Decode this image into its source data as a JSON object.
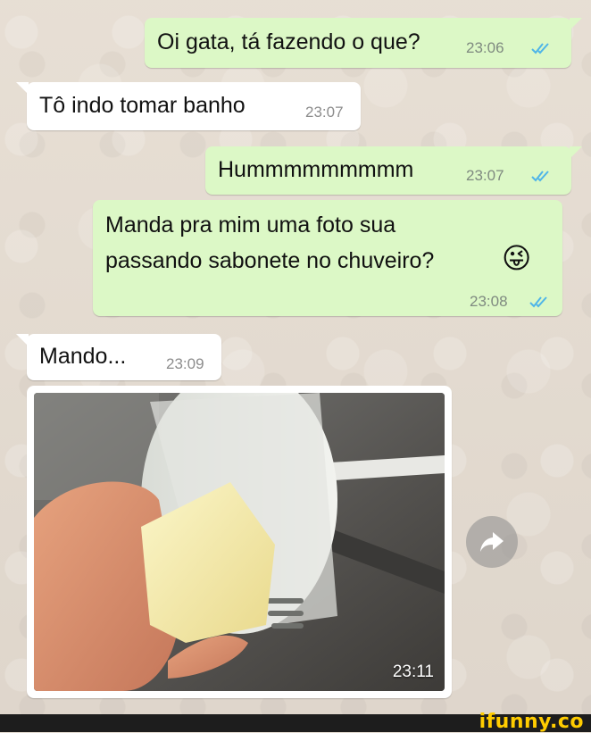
{
  "conversation": {
    "messages": [
      {
        "direction": "outgoing",
        "text": "Oi gata, tá fazendo o que?",
        "time": "23:06",
        "status": "read"
      },
      {
        "direction": "incoming",
        "text": "Tô indo tomar banho",
        "time": "23:07"
      },
      {
        "direction": "outgoing",
        "text": "Hummmmmmmmm",
        "time": "23:07",
        "status": "read"
      },
      {
        "direction": "outgoing",
        "text": "Manda pra mim uma foto sua\npassando sabonete no chuveiro?",
        "emoji": "😜",
        "time": "23:08",
        "status": "read"
      },
      {
        "direction": "incoming",
        "text": "Mando...",
        "time": "23:09"
      },
      {
        "direction": "incoming",
        "type": "image",
        "time": "23:11"
      }
    ]
  },
  "icons": {
    "read_receipt": "double-check-icon",
    "forward": "forward-icon"
  },
  "colors": {
    "outgoing_bubble": "#dcf8c6",
    "incoming_bubble": "#ffffff",
    "read_tick": "#4fb5e8",
    "wallpaper": "#e6ddd2"
  },
  "watermark": {
    "text": "ifunny.co"
  }
}
